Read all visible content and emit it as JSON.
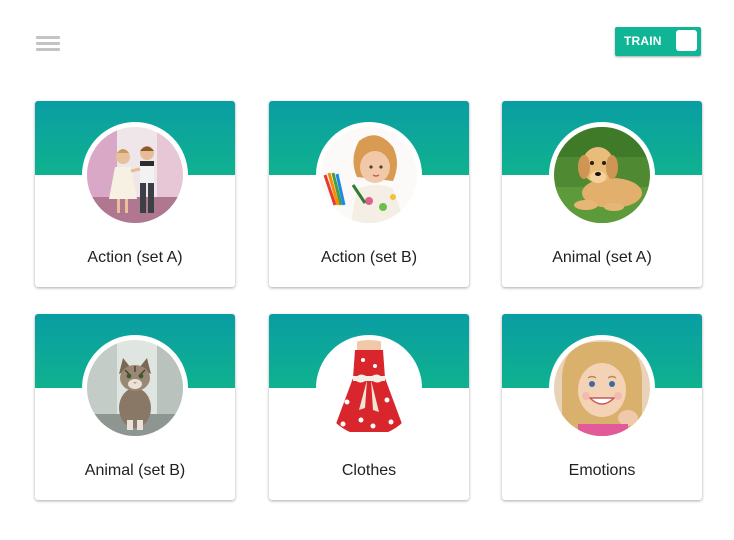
{
  "header": {
    "menu_icon": "hamburger-menu-icon",
    "train_toggle": {
      "label": "TRAIN",
      "state": "on",
      "color": "#10b596"
    }
  },
  "colors": {
    "banner_top": "#0a9da3",
    "banner_bottom": "#0fb28f"
  },
  "categories": [
    {
      "label": "Action (set A)",
      "image": "children-dancing"
    },
    {
      "label": "Action (set B)",
      "image": "girl-drawing"
    },
    {
      "label": "Animal (set A)",
      "image": "golden-retriever-puppy"
    },
    {
      "label": "Animal (set B)",
      "image": "tabby-kitten"
    },
    {
      "label": "Clothes",
      "image": "red-floral-dress"
    },
    {
      "label": "Emotions",
      "image": "smiling-girl"
    }
  ]
}
